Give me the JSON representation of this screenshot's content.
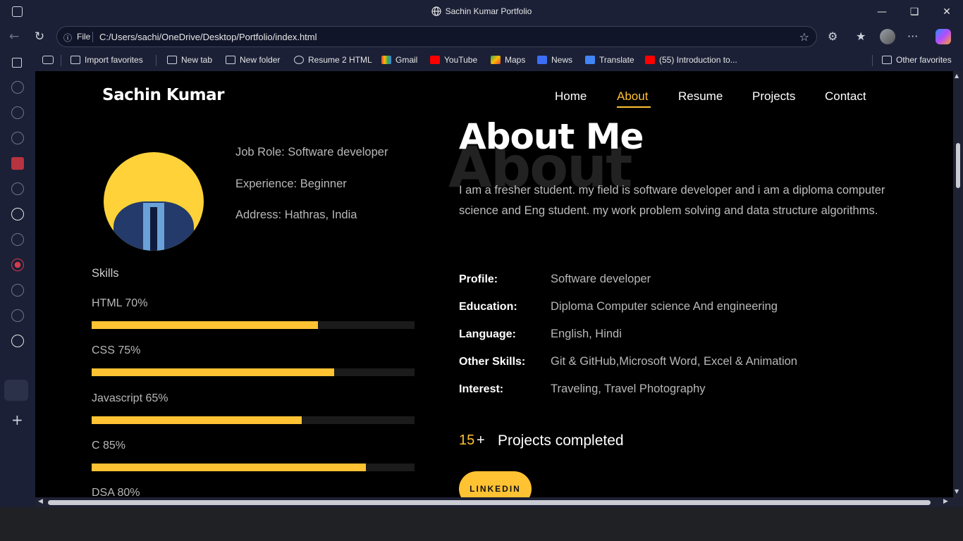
{
  "browser": {
    "window_title": "Sachin Kumar Portfolio",
    "address_scheme": "File",
    "address_url": "C:/Users/sachi/OneDrive/Desktop/Portfolio/index.html",
    "favorites": [
      "Import favorites",
      "New tab",
      "New folder",
      "Resume 2 HTML",
      "Gmail",
      "YouTube",
      "Maps",
      "News",
      "Translate",
      "(55) Introduction to..."
    ],
    "other_favorites": "Other favorites"
  },
  "site": {
    "brand": "Sachin Kumar",
    "nav": [
      "Home",
      "About",
      "Resume",
      "Projects",
      "Contact"
    ],
    "active_nav": "About"
  },
  "profile": {
    "job_role": "Job Role: Software developer",
    "experience": "Experience: Beginner",
    "address": "Address: Hathras, India"
  },
  "skills": {
    "title": "Skills",
    "items": [
      {
        "label": "HTML 70%",
        "percent": 70
      },
      {
        "label": "CSS 75%",
        "percent": 75
      },
      {
        "label": "Javascript 65%",
        "percent": 65
      },
      {
        "label": "C 85%",
        "percent": 85
      },
      {
        "label": "DSA 80%",
        "percent": 80
      }
    ]
  },
  "about": {
    "bg_word": "About",
    "title": "About Me",
    "description": "I am a fresher student. my field is software developer and i am a diploma computer science and Eng student. my work problem solving and data structure algorithms.",
    "details": [
      {
        "key": "Profile:",
        "value": "Software developer"
      },
      {
        "key": "Education:",
        "value": "Diploma Computer science And engineering"
      },
      {
        "key": "Language:",
        "value": "English, Hindi"
      },
      {
        "key": "Other Skills:",
        "value": "Git & GitHub,Microsoft Word, Excel & Animation"
      },
      {
        "key": "Interest:",
        "value": "Traveling, Travel Photography"
      }
    ],
    "projects_count": "15",
    "projects_plus": "+",
    "projects_label": "Projects completed",
    "linkedin_label": "LINKEDIN"
  },
  "colors": {
    "accent": "#ffc233",
    "page_bg": "#000000",
    "browser_chrome": "#1b2036"
  }
}
